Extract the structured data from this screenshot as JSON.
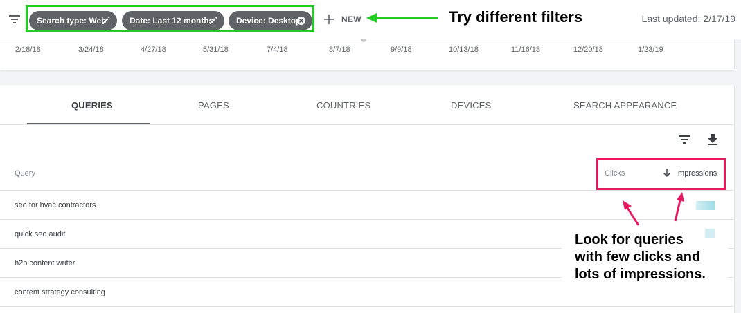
{
  "toolbar": {
    "chips": [
      {
        "label": "Search type: Web",
        "icon": "pencil-icon"
      },
      {
        "label": "Date: Last 12 months",
        "icon": "pencil-icon"
      },
      {
        "label": "Device: Desktop",
        "icon": "clear-icon"
      }
    ],
    "new_label": "NEW",
    "last_updated": "Last updated: 2/17/19"
  },
  "annotations": {
    "filters_note": "Try different filters",
    "queries_note": [
      "Look for queries",
      "with few clicks and",
      "lots of impressions."
    ]
  },
  "chart": {
    "x_ticks": [
      "2/18/18",
      "3/24/18",
      "4/27/18",
      "5/31/18",
      "7/4/18",
      "8/7/18",
      "9/9/18",
      "10/13/18",
      "11/16/18",
      "12/20/18",
      "1/23/19"
    ]
  },
  "tabs": [
    {
      "label": "QUERIES",
      "active": true
    },
    {
      "label": "PAGES",
      "active": false
    },
    {
      "label": "COUNTRIES",
      "active": false
    },
    {
      "label": "DEVICES",
      "active": false
    },
    {
      "label": "SEARCH APPEARANCE",
      "active": false
    }
  ],
  "table": {
    "columns": {
      "query": "Query",
      "clicks": "Clicks",
      "impressions": "Impressions"
    },
    "rows": [
      {
        "query": "seo for hvac contractors"
      },
      {
        "query": "quick seo audit"
      },
      {
        "query": "b2b content writer"
      },
      {
        "query": "content strategy consulting"
      }
    ]
  },
  "colors": {
    "chip_bg": "#5f6368",
    "green_highlight": "#22cc22",
    "pink_highlight": "#e5195e",
    "blurred_bar": "#9fdde8"
  }
}
